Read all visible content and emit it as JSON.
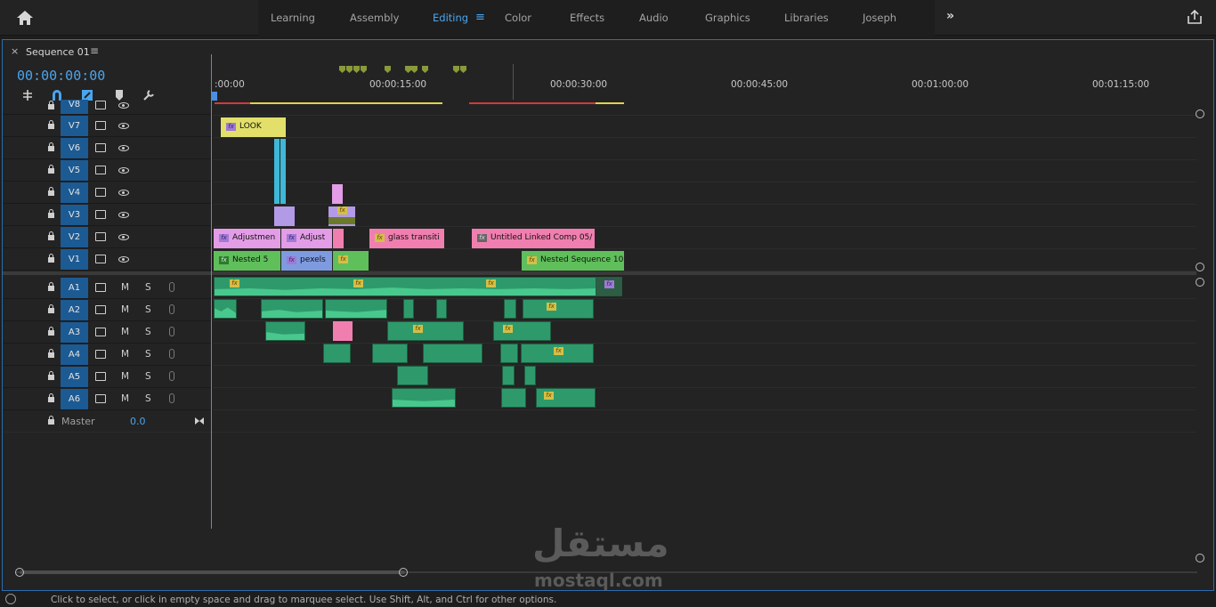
{
  "topbar": {
    "tabs": [
      "Learning",
      "Assembly",
      "Editing",
      "Color",
      "Effects",
      "Audio",
      "Graphics",
      "Libraries",
      "Joseph"
    ],
    "active_tab": "Editing",
    "more_label": "»"
  },
  "panel": {
    "close_label": "×",
    "sequence_title": "Sequence 01",
    "menu_label": "≡",
    "timecode": "00:00:00:00"
  },
  "ruler": {
    "labels": [
      ":00:00",
      "00:00:15:00",
      "00:00:30:00",
      "00:00:45:00",
      "00:01:00:00",
      "00:01:15:00"
    ]
  },
  "video_tracks": [
    "V8",
    "V7",
    "V6",
    "V5",
    "V4",
    "V3",
    "V2",
    "V1"
  ],
  "audio_tracks": [
    "A1",
    "A2",
    "A3",
    "A4",
    "A5",
    "A6"
  ],
  "audio_buttons": {
    "mute": "M",
    "solo": "S"
  },
  "master": {
    "label": "Master",
    "value": "0.0"
  },
  "clips": {
    "look": "LOOK",
    "adjustment1": "Adjustmen",
    "adjustment2": "Adjust",
    "glass": "glass transiti",
    "untitled": "Untitled Linked Comp 05/",
    "nested5": "Nested 5",
    "pexels": "pexels",
    "nested10": "Nested Sequence 10"
  },
  "fx_label": "fx",
  "status": {
    "text": "Click to select, or click in empty space and drag to marquee select. Use Shift, Alt, and Ctrl for other options."
  },
  "watermark": {
    "arabic": "مستقل",
    "latin": "mostaql.com"
  },
  "colors": {
    "accent": "#4aa5ef",
    "track_label": "#1c5a93",
    "clip_yellow": "#e2e06a",
    "clip_pink": "#f07fb0",
    "clip_violet": "#e39de6",
    "clip_green": "#5fbf5a",
    "clip_blue": "#7f9be0",
    "clip_cyan": "#3fb7d6",
    "audio_green": "#2e9a6b"
  }
}
